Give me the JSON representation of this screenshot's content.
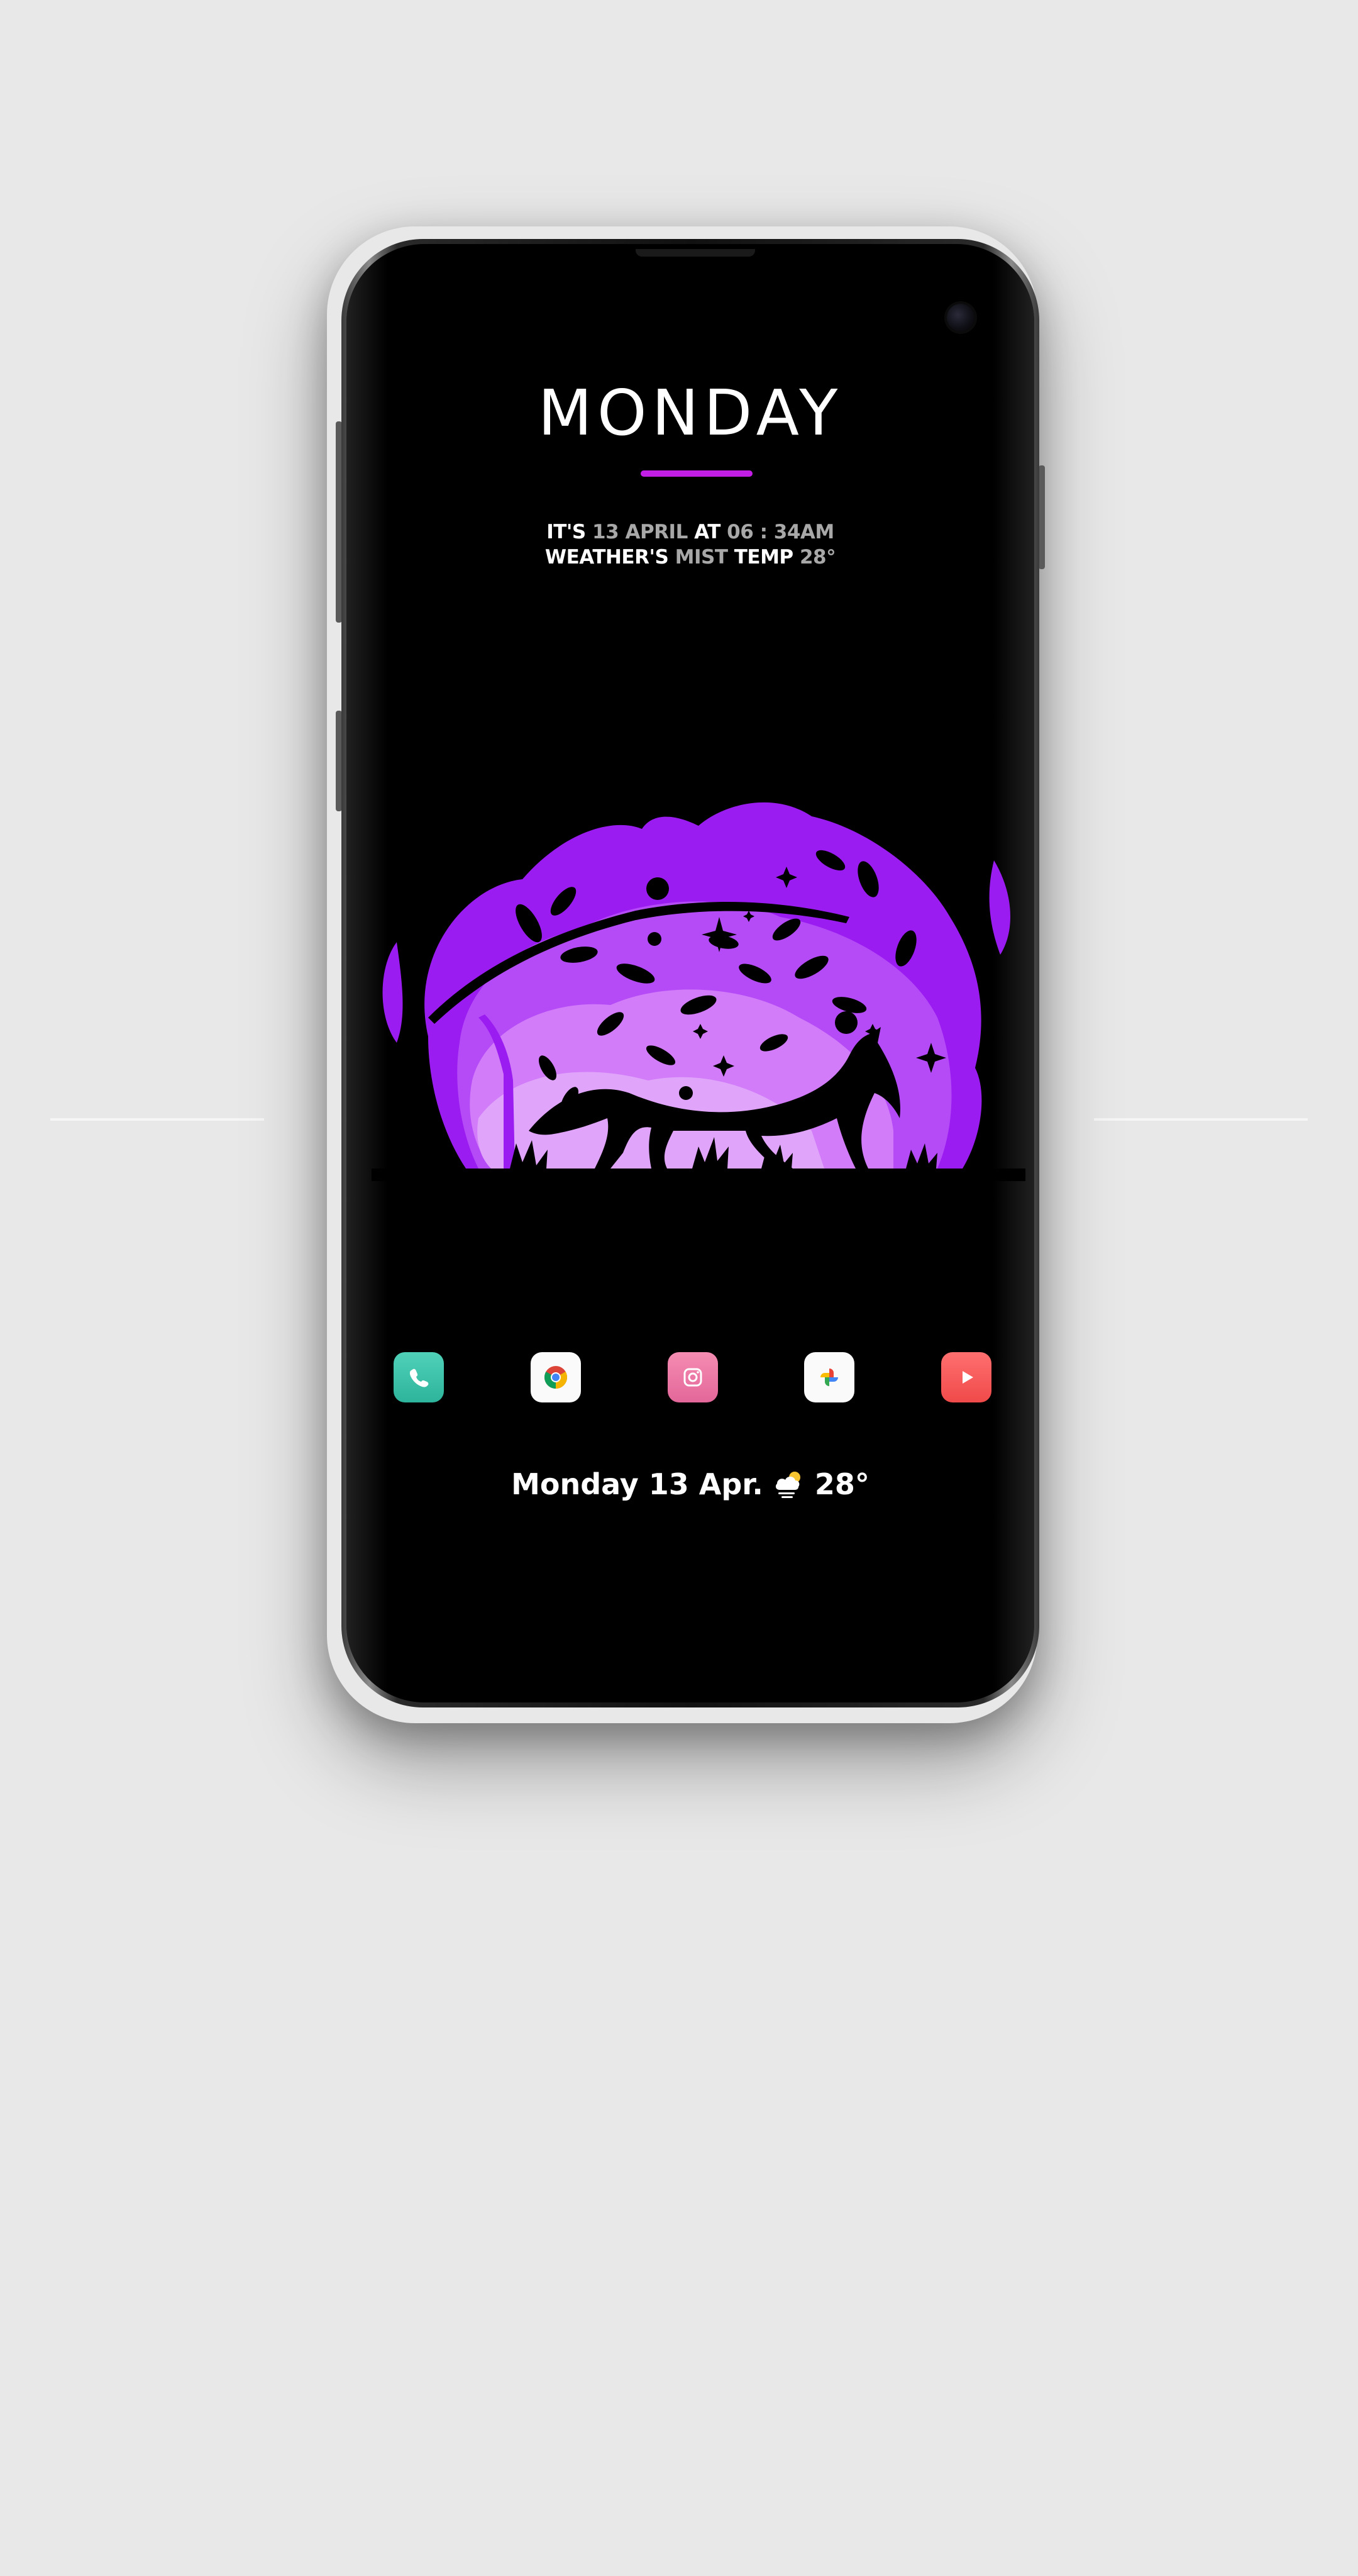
{
  "lockscreen": {
    "day": "MONDAY",
    "line1": {
      "p1": "IT'S",
      "date": "13 APRIL",
      "p2": "AT",
      "time": "06 : 34AM"
    },
    "line2": {
      "p1": "WEATHER'S",
      "condition": "MIST",
      "p2": "TEMP",
      "temp": "28°"
    }
  },
  "dock": {
    "apps": [
      {
        "name": "phone-icon",
        "color": "#3cc3aa"
      },
      {
        "name": "chrome-icon",
        "color": "#fafafa"
      },
      {
        "name": "camera-icon",
        "color": "#ea76a4"
      },
      {
        "name": "photos-icon",
        "color": "#fafafa"
      },
      {
        "name": "youtube-icon",
        "color": "#f85a5a"
      }
    ]
  },
  "widget": {
    "date_text": "Monday 13 Apr.",
    "weather_icon": "cloud-sun-icon",
    "temp": "28°"
  },
  "colors": {
    "accent": "#c21ee6",
    "background": "#000000",
    "art_purple_dark": "#9b1cf0",
    "art_purple_mid": "#b54bf7",
    "art_purple_light": "#e0a4fb"
  }
}
